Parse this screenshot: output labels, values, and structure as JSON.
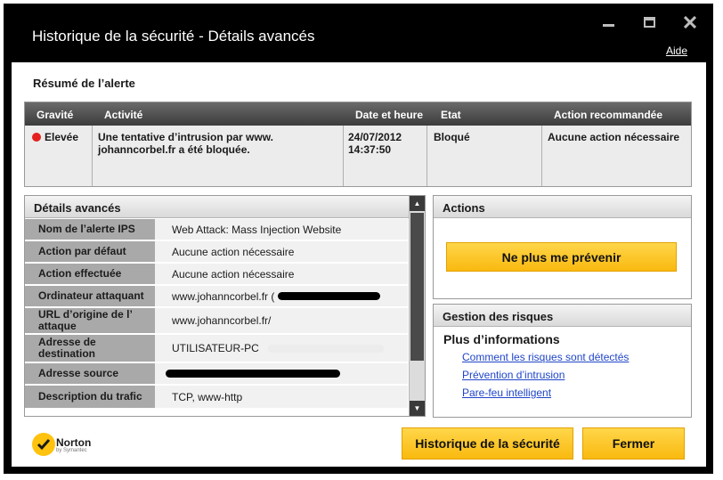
{
  "window": {
    "title": "Historique de la sécurité - Détails avancés",
    "help": "Aide",
    "controls": [
      "minimize-icon",
      "maximize-icon",
      "close-icon"
    ]
  },
  "summary": {
    "title": "Résumé de l’alerte",
    "headers": [
      "Gravité",
      "Activité",
      "Date et heure",
      "Etat",
      "Action recommandée"
    ],
    "row": {
      "severity": "Elevée",
      "severity_color": "#e52020",
      "activity_line1": "Une tentative d’intrusion par www.",
      "activity_line2": "johanncorbel.fr a été bloquée.",
      "date": "24/07/2012",
      "time": "14:37:50",
      "status": "Bloqué",
      "recommended": "Aucune action nécessaire"
    }
  },
  "details": {
    "title": "Détails avancés",
    "rows": [
      {
        "label": "Nom de l’alerte IPS",
        "value": "Web Attack: Mass Injection Website"
      },
      {
        "label": "Action par défaut",
        "value": "Aucune action nécessaire"
      },
      {
        "label": "Action effectuée",
        "value": "Aucune action nécessaire"
      },
      {
        "label": "Ordinateur attaquant",
        "value": "www.johanncorbel.fr ("
      },
      {
        "label": "URL d’origine de l’ attaque",
        "value": "www.johanncorbel.fr/"
      },
      {
        "label": "Adresse de destination",
        "value": "UTILISATEUR-PC"
      },
      {
        "label": "Adresse source",
        "value": ""
      },
      {
        "label": "Description du trafic",
        "value": "TCP, www-http"
      }
    ]
  },
  "actions": {
    "title": "Actions",
    "button": "Ne plus me prévenir"
  },
  "risk": {
    "title": "Gestion des risques",
    "subtitle": "Plus d’informations",
    "links": [
      "Comment les risques sont détectés",
      "Prévention d’intrusion",
      "Pare-feu intelligent"
    ]
  },
  "footer": {
    "logo": "Norton",
    "logo_sub": "by Symantec",
    "history_button": "Historique de la sécurité",
    "close_button": "Fermer"
  },
  "colors": {
    "accent_yellow": "#f9b90f",
    "link_blue": "#1f45c8",
    "header_dark": "#4a4a4a"
  }
}
